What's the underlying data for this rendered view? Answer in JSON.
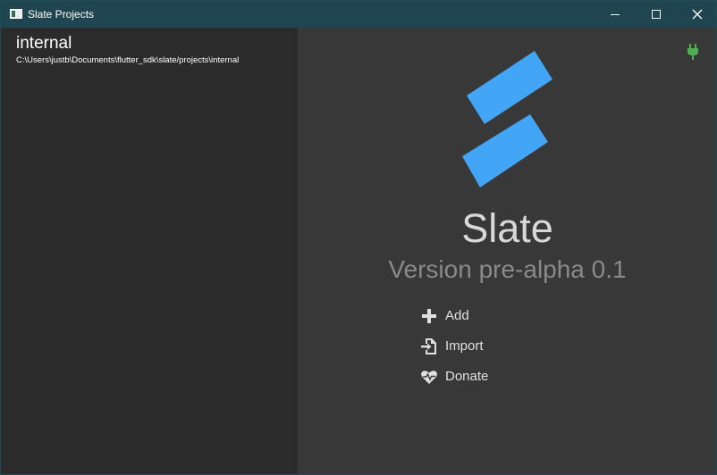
{
  "window": {
    "title": "Slate Projects"
  },
  "sidebar": {
    "projects": [
      {
        "name": "internal",
        "path": "C:\\Users\\justb\\Documents\\flutter_sdk\\slate/projects\\internal"
      }
    ]
  },
  "main": {
    "app_name": "Slate",
    "version": "Version pre-alpha 0.1",
    "actions": [
      {
        "label": "Add",
        "icon": "plus-icon"
      },
      {
        "label": "Import",
        "icon": "import-icon"
      },
      {
        "label": "Donate",
        "icon": "heart-pulse-icon"
      }
    ],
    "status_icon": "plug-icon"
  },
  "colors": {
    "titlebar": "#1f4550",
    "sidebar": "#2b2b2b",
    "main": "#383838",
    "logo_blue": "#42a5f5",
    "plug_green": "#4caf50"
  }
}
